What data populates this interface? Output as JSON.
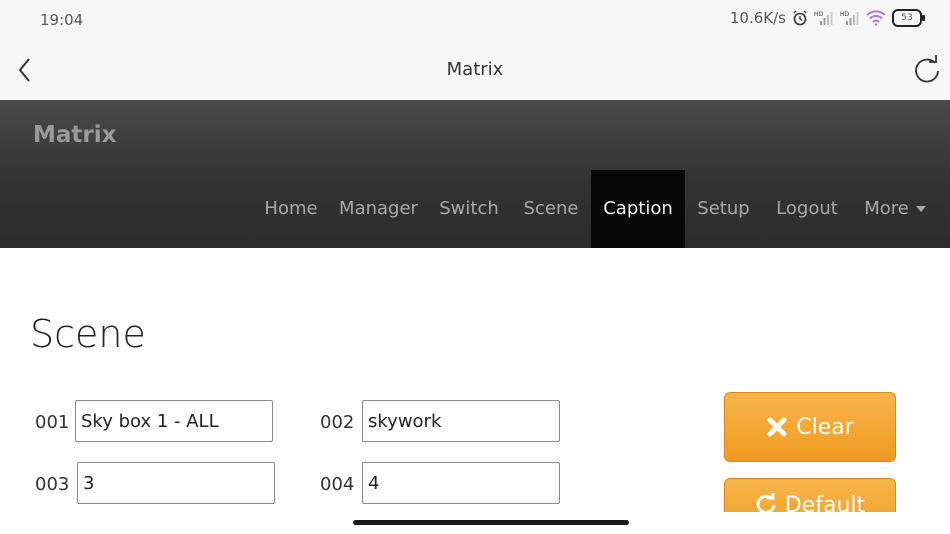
{
  "status_bar": {
    "time": "19:04",
    "speed": "10.6K/s",
    "battery": "53",
    "icons": [
      "alarm-icon",
      "signal-hd-icon",
      "signal-hd-icon",
      "wifi-icon",
      "battery-icon"
    ]
  },
  "app_bar": {
    "title": "Matrix",
    "back_icon": "chevron-left-icon",
    "refresh_icon": "refresh-icon"
  },
  "web_nav": {
    "brand": "Matrix",
    "items": [
      {
        "label": "Home"
      },
      {
        "label": "Manager"
      },
      {
        "label": "Switch"
      },
      {
        "label": "Scene"
      },
      {
        "label": "Caption",
        "active": true
      },
      {
        "label": "Setup"
      },
      {
        "label": "Logout"
      },
      {
        "label": "More"
      }
    ]
  },
  "content": {
    "title": "Scene",
    "fields": [
      {
        "label": "001 :",
        "value": "Sky box 1 - ALL"
      },
      {
        "label": "002 :",
        "value": "skywork"
      },
      {
        "label": "003 :",
        "value": "3"
      },
      {
        "label": "004 :",
        "value": "4"
      }
    ],
    "buttons": {
      "clear_label": "Clear",
      "default_label": "Default"
    }
  },
  "colors": {
    "nav_active": "#080808",
    "button_orange": "#f0a030"
  }
}
